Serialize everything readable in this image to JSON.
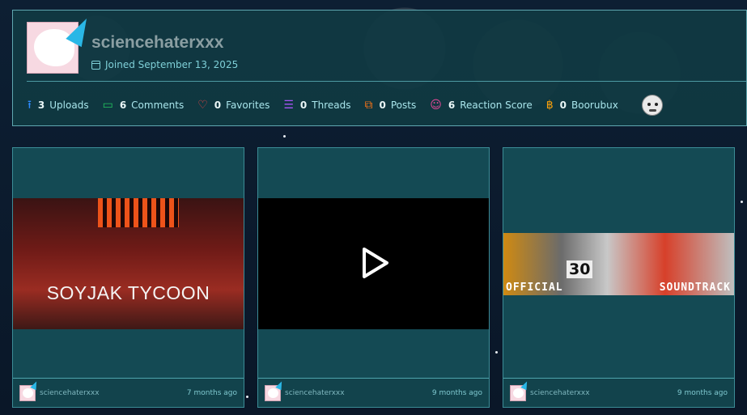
{
  "profile": {
    "username": "sciencehaterxxx",
    "joined": "Joined September 13, 2025",
    "stats": [
      {
        "icon": "upload-icon",
        "glyph": "⭱",
        "color": "#2e8cff",
        "count": "3",
        "label": "Uploads"
      },
      {
        "icon": "comment-icon",
        "glyph": "▭",
        "color": "#22c55e",
        "count": "6",
        "label": "Comments"
      },
      {
        "icon": "heart-icon",
        "glyph": "♡",
        "color": "#ef4444",
        "count": "0",
        "label": "Favorites"
      },
      {
        "icon": "thread-icon",
        "glyph": "☰",
        "color": "#a855f7",
        "count": "0",
        "label": "Threads"
      },
      {
        "icon": "posts-icon",
        "glyph": "⧉",
        "color": "#f97316",
        "count": "0",
        "label": "Posts"
      },
      {
        "icon": "reaction-icon",
        "glyph": "☺",
        "color": "#ec4899",
        "count": "6",
        "label": "Reaction Score"
      },
      {
        "icon": "boorubux-icon",
        "glyph": "฿",
        "color": "#f59e0b",
        "count": "0",
        "label": "Boorubux"
      }
    ]
  },
  "cards": [
    {
      "image_title": "SOYJAK TYCOON",
      "author": "sciencehaterxxx",
      "time": "7 months ago"
    },
    {
      "author": "sciencehaterxxx",
      "time": "9 months ago"
    },
    {
      "image_left": "OFFICIAL",
      "image_right": "SOUNDTRACK",
      "image_num": "30",
      "author": "sciencehaterxxx",
      "time": "9 months ago"
    }
  ]
}
